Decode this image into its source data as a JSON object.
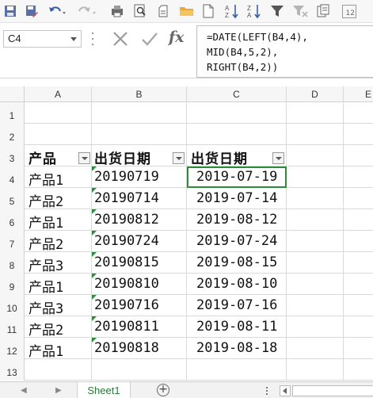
{
  "name_box": {
    "value": "C4"
  },
  "formula_bar": {
    "fx_label": "fx",
    "lines": [
      "=DATE(LEFT(B4,4),",
      "MID(B4,5,2),",
      "RIGHT(B4,2))"
    ]
  },
  "toolbar": {
    "icons": [
      "save-icon",
      "save-as-icon",
      "undo-icon",
      "redo-icon",
      "format-painter-icon",
      "print-preview-icon",
      "print-icon",
      "open-folder-icon",
      "new-document-icon",
      "sort-ascending-icon",
      "sort-descending-icon",
      "filter-icon",
      "clear-filter-icon",
      "paste-icon",
      "subscript-icon"
    ],
    "subscript_label": "12"
  },
  "columns": [
    "A",
    "B",
    "C",
    "D",
    "E"
  ],
  "rows": [
    {
      "num": "1",
      "a": "",
      "b": "",
      "c": ""
    },
    {
      "num": "2",
      "a": "",
      "b": "",
      "c": ""
    },
    {
      "num": "3",
      "a": "产品",
      "b": "出货日期",
      "c": "出货日期"
    },
    {
      "num": "4",
      "a": "产品1",
      "b": "20190719",
      "c": "2019-07-19"
    },
    {
      "num": "5",
      "a": "产品2",
      "b": "20190714",
      "c": "2019-07-14"
    },
    {
      "num": "6",
      "a": "产品1",
      "b": "20190812",
      "c": "2019-08-12"
    },
    {
      "num": "7",
      "a": "产品2",
      "b": "20190724",
      "c": "2019-07-24"
    },
    {
      "num": "8",
      "a": "产品3",
      "b": "20190815",
      "c": "2019-08-15"
    },
    {
      "num": "9",
      "a": "产品1",
      "b": "20190810",
      "c": "2019-08-10"
    },
    {
      "num": "10",
      "a": "产品3",
      "b": "20190716",
      "c": "2019-07-16"
    },
    {
      "num": "11",
      "a": "产品2",
      "b": "20190811",
      "c": "2019-08-11"
    },
    {
      "num": "12",
      "a": "产品1",
      "b": "20190818",
      "c": "2019-08-18"
    },
    {
      "num": "13",
      "a": "",
      "b": "",
      "c": ""
    }
  ],
  "sheet_tabs": [
    {
      "label": "Sheet1",
      "active": true
    }
  ],
  "colors": {
    "accent_green": "#2e8b3c",
    "sheet_tab_text": "#2a7a3a",
    "header_bg": "#f6f6f6"
  }
}
